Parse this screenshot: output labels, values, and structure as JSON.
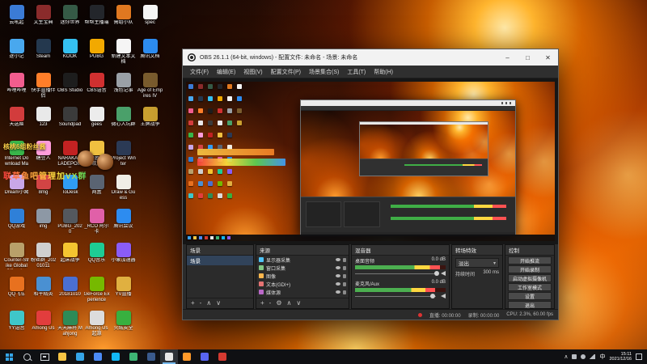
{
  "desktop": {
    "banner": {
      "line1": "核桃6组粉丝酱",
      "line2": "联草鱼吧管理加VX群"
    },
    "icons": [
      {
        "label": "云吼起",
        "color": "#3b7bd6"
      },
      {
        "label": "逐小记",
        "color": "#49a8ee"
      },
      {
        "label": "哔哩哔哩",
        "color": "#f25d8e"
      },
      {
        "label": "天选姬",
        "color": "#d23c3c"
      },
      {
        "label": "Internet Download Manager",
        "color": "#39b54a"
      },
      {
        "label": "Dream小窝",
        "color": "#c9a7e8"
      },
      {
        "label": "QQ游戏",
        "color": "#2f80d8"
      },
      {
        "label": "Counter-Strike Global Offensive",
        "color": "#b9a06a"
      },
      {
        "label": "QQ飞车",
        "color": "#e8711f"
      },
      {
        "label": "YY语音",
        "color": "#3fc6c9"
      },
      {
        "label": "文生宝典",
        "color": "#8a2b2b"
      },
      {
        "label": "Steam",
        "color": "#24384e"
      },
      {
        "label": "快手直播伴侣",
        "color": "#ff7e29"
      },
      {
        "label": "123",
        "color": "#e9e9e9"
      },
      {
        "label": "糖豆人",
        "color": "#ff9ddb"
      },
      {
        "label": "8mg",
        "color": "#d24444"
      },
      {
        "label": "img",
        "color": "#8d98a5"
      },
      {
        "label": "粉丝群_20201011",
        "color": "#cfcfcf"
      },
      {
        "label": "和平精英",
        "color": "#4a90d2"
      },
      {
        "label": "Among Us",
        "color": "#e23d3d"
      },
      {
        "label": "迷你世界",
        "color": "#355a46"
      },
      {
        "label": "KOOK",
        "color": "#35c0f0"
      },
      {
        "label": "OBS Studio",
        "color": "#1d1d1d"
      },
      {
        "label": "Soundpad",
        "color": "#3b3b3b"
      },
      {
        "label": "NARAKA BLADEPOINT",
        "color": "#c22222"
      },
      {
        "label": "ToDesk",
        "color": "#2f9cf4"
      },
      {
        "label": "PUBG_2020",
        "color": "#54585e"
      },
      {
        "label": "起床战争",
        "color": "#f4c430"
      },
      {
        "label": "20181010",
        "color": "#4a6fd2"
      },
      {
        "label": "天天麻将 Mahjong",
        "color": "#2e8b57"
      },
      {
        "label": "帮帮主播端",
        "color": "#23262b"
      },
      {
        "label": "PUBG",
        "color": "#f2a900"
      },
      {
        "label": "CBS语音",
        "color": "#d03030"
      },
      {
        "label": "gees",
        "color": "#ececec"
      },
      {
        "label": "王团团入群欢迎",
        "color": "#f0c040"
      },
      {
        "label": "两盒",
        "color": "#5a6472"
      },
      {
        "label": "_RCO 阿尔卡",
        "color": "#e060a8"
      },
      {
        "label": "QQ音乐",
        "color": "#1ecc94"
      },
      {
        "label": "GeForce Experience",
        "color": "#76b900"
      },
      {
        "label": "Among Us 起源",
        "color": "#dcdcdc"
      },
      {
        "label": "需组小队",
        "color": "#e07820"
      },
      {
        "label": "新建文本文档",
        "color": "#f5f5f5"
      },
      {
        "label": "浅色记事",
        "color": "#9aa0a6"
      },
      {
        "label": "微心入坑群",
        "color": "#4aa06a"
      },
      {
        "label": "Project Winter",
        "color": "#2b3a55"
      },
      {
        "label": "Draw & Guess",
        "color": "#f0eee6"
      },
      {
        "label": "腾讯会议",
        "color": "#2d8cf0"
      },
      {
        "label": "小象加速器",
        "color": "#8a5cf6"
      },
      {
        "label": "YV直播",
        "color": "#e0b040"
      },
      {
        "label": "火绒安全",
        "color": "#38b03f"
      },
      {
        "label": "spec",
        "color": "#f5f5f5"
      },
      {
        "label": "腾讯文档",
        "color": "#2d8cf0"
      },
      {
        "label": "Age of Empires IV",
        "color": "#7a5c2e"
      },
      {
        "label": "王牌战争",
        "color": "#caa030"
      }
    ]
  },
  "obs": {
    "title": "OBS 26.1.1 (64-bit, windows) - 配置文件: 未命名 - 场景: 未命名",
    "window_buttons": {
      "min": "–",
      "max": "□",
      "close": "✕"
    },
    "menu": [
      {
        "label": "文件(F)"
      },
      {
        "label": "编辑(E)"
      },
      {
        "label": "视图(V)"
      },
      {
        "label": "配置文件(P)"
      },
      {
        "label": "场景集合(S)"
      },
      {
        "label": "工具(T)"
      },
      {
        "label": "帮助(H)"
      }
    ],
    "scenes": {
      "title": "场景",
      "items": [
        {
          "name": "场景"
        }
      ],
      "tools": [
        "+",
        "-",
        "∧",
        "∨"
      ]
    },
    "sources": {
      "title": "来源",
      "items": [
        {
          "name": "显示器采集",
          "color": "#4fc3f7"
        },
        {
          "name": "窗口采集",
          "color": "#81c784"
        },
        {
          "name": "图像",
          "color": "#ffb74d"
        },
        {
          "name": "文本(GDI+)",
          "color": "#e57373"
        },
        {
          "name": "媒体源",
          "color": "#ba68c8"
        }
      ],
      "tools": [
        "+",
        "-",
        "⚙",
        "∧",
        "∨"
      ]
    },
    "mixer": {
      "title": "混音器",
      "channels": [
        {
          "name": "桌面音频",
          "db": "0.0 dB",
          "level": "94%",
          "slider": "90%"
        },
        {
          "name": "麦克风/Aux",
          "db": "0.0 dB",
          "level": "88%",
          "slider": "86%"
        }
      ]
    },
    "transitions": {
      "title": "转场特效",
      "selected": "淡出",
      "duration_label": "持续时间",
      "duration": "300 ms"
    },
    "controls": {
      "title": "控制",
      "buttons": [
        {
          "label": "开始推流"
        },
        {
          "label": "开始录制"
        },
        {
          "label": "启动虚拟摄像机"
        },
        {
          "label": "工作室模式"
        },
        {
          "label": "设置"
        },
        {
          "label": "退出"
        }
      ]
    },
    "status": {
      "live": "直播: 00:00:00",
      "rec": "录制: 00:00:00",
      "cpu": "CPU: 2.3%, 60.00 fps"
    }
  },
  "taskbar": {
    "apps": [
      {
        "name": "file-explorer",
        "color": "#f6c444"
      },
      {
        "name": "edge",
        "color": "#35a5e8"
      },
      {
        "name": "chrome",
        "color": "#4c8bf5"
      },
      {
        "name": "qq",
        "color": "#12b7f5"
      },
      {
        "name": "wechat",
        "color": "#3eb575"
      },
      {
        "name": "steam",
        "color": "#3a5a8c"
      },
      {
        "name": "obs",
        "color": "#e8e8e8",
        "bg": "#2e3238",
        "ul": "#76b9ed"
      },
      {
        "name": "wegame",
        "color": "#ff9a2a"
      },
      {
        "name": "discord",
        "color": "#5865f2"
      },
      {
        "name": "netease-music",
        "color": "#d33a31"
      }
    ],
    "lang": "中",
    "time": "15:11",
    "date": "2021/12/16"
  }
}
